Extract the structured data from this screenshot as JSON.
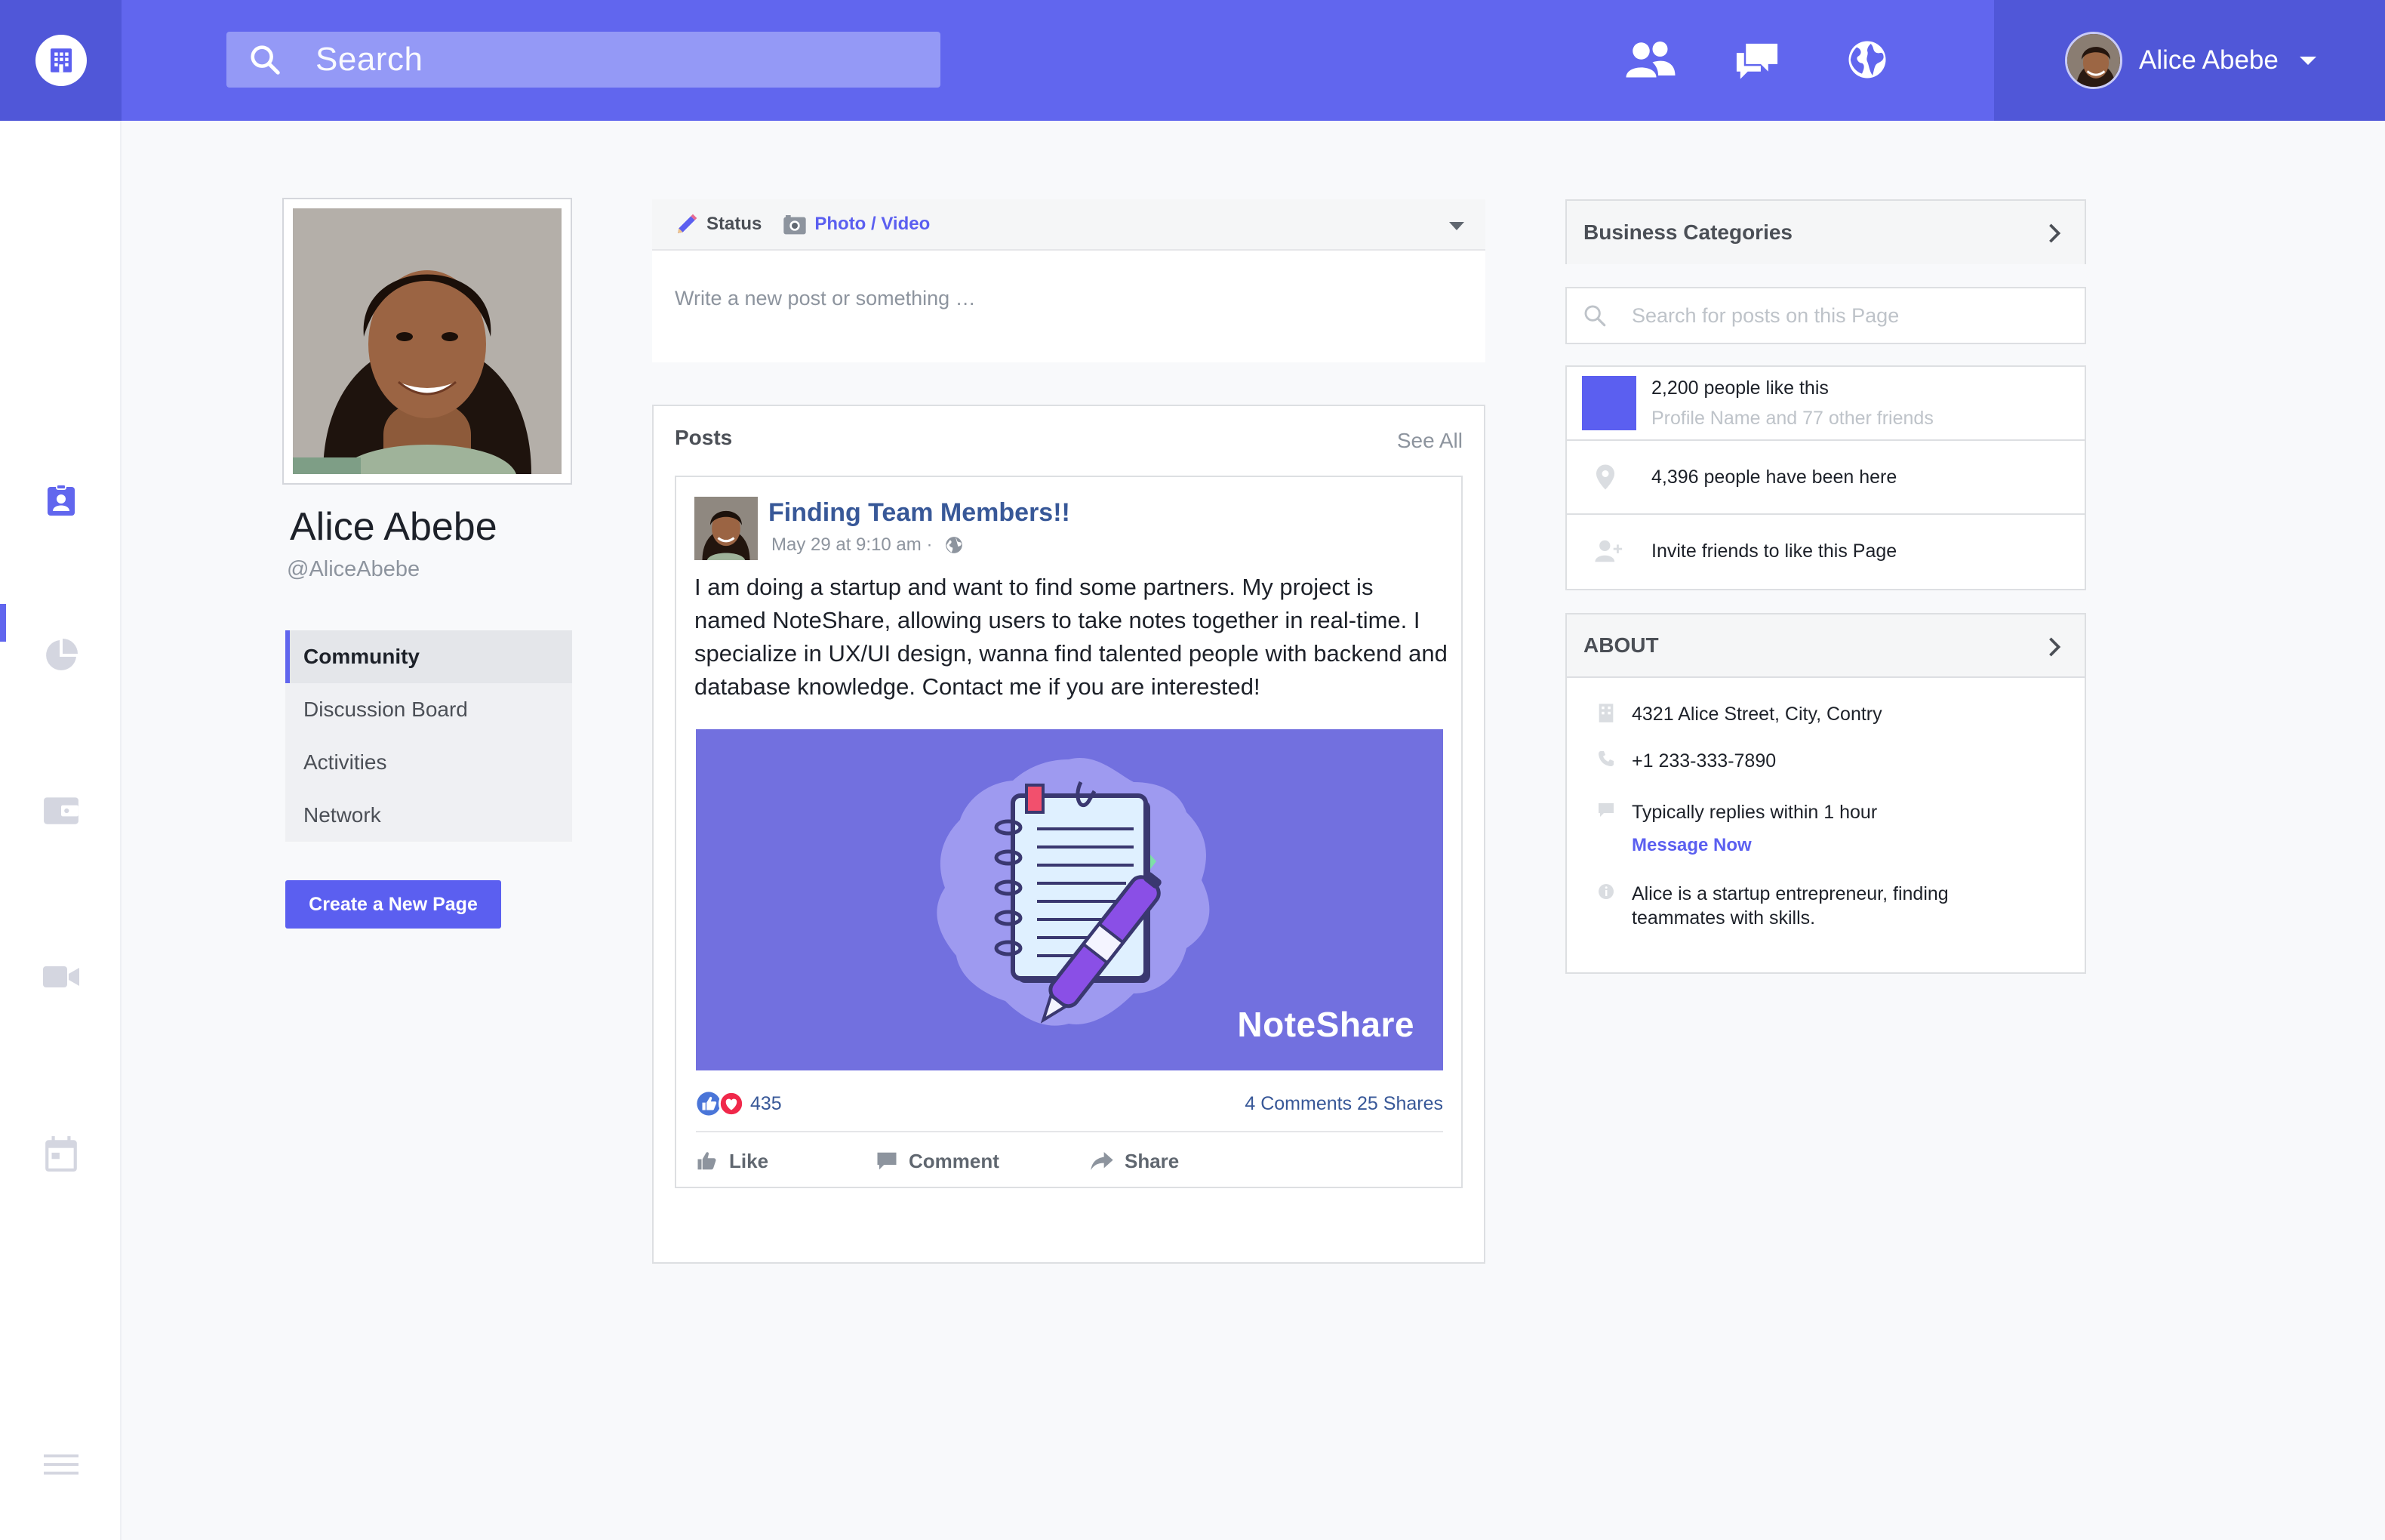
{
  "topbar": {
    "search_placeholder": "Search",
    "user_name": "Alice Abebe"
  },
  "profile": {
    "name": "Alice Abebe",
    "handle": "@AliceAbebe",
    "menu": [
      {
        "label": "Community",
        "active": true
      },
      {
        "label": "Discussion Board",
        "active": false
      },
      {
        "label": "Activities",
        "active": false
      },
      {
        "label": "Network",
        "active": false
      }
    ],
    "create_page_label": "Create a New Page"
  },
  "composer": {
    "status_label": "Status",
    "photo_label": "Photo / Video",
    "placeholder": "Write a new post or something …"
  },
  "posts": {
    "title": "Posts",
    "see_all": "See All",
    "post": {
      "title": "Finding Team Members!!",
      "meta": "May 29 at 9:10 am ·",
      "body": "I am doing a startup and want to find some partners. My project is named NoteShare, allowing users to take notes together in real-time. I specialize in UX/UI design, wanna find talented people with backend and database knowledge. Contact me if you are interested!",
      "image_label": "NoteShare",
      "reactions_count": "435",
      "comments_shares": "4 Comments 25 Shares",
      "actions": {
        "like": "Like",
        "comment": "Comment",
        "share": "Share"
      }
    }
  },
  "sidebar_right": {
    "categories_title": "Business Categories",
    "search_placeholder": "Search for posts on this Page",
    "likes": {
      "count_text": "2,200 people like this",
      "friends_text": "Profile Name and 77 other friends",
      "visits_text": "4,396 people have been here",
      "invite_text": "Invite friends to like this Page"
    },
    "about": {
      "title": "ABOUT",
      "address": "4321 Alice Street, City, Contry",
      "phone": "+1 233-333-7890",
      "reply_time": "Typically replies within 1 hour",
      "message_link": "Message Now",
      "bio": "Alice is a startup entrepreneur, finding teammates with skills."
    }
  },
  "colors": {
    "accent": "#6166ee",
    "accent_dark": "#5057d8",
    "link": "#385898",
    "image_bg": "#7270df"
  }
}
